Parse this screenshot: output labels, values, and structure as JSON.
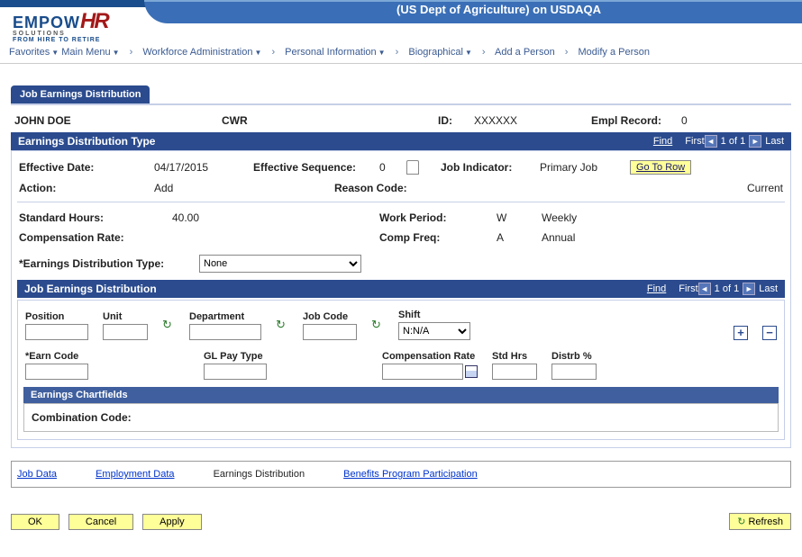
{
  "header": {
    "system_title": "(US Dept of Agriculture) on USDAQA",
    "logo_main": "EMPOW",
    "logo_hr": "HR",
    "logo_sub": "SOLUTIONS",
    "logo_tag": "FROM HIRE TO RETIRE"
  },
  "breadcrumbs": {
    "items": [
      {
        "label": "Favorites",
        "dropdown": true
      },
      {
        "label": "Main Menu",
        "dropdown": true
      },
      {
        "label": "Workforce Administration",
        "dropdown": true
      },
      {
        "label": "Personal Information",
        "dropdown": true
      },
      {
        "label": "Biographical",
        "dropdown": true
      },
      {
        "label": "Add a Person",
        "dropdown": false
      },
      {
        "label": "Modify a Person",
        "dropdown": false
      }
    ]
  },
  "tab": {
    "label": "Job Earnings Distribution"
  },
  "person": {
    "name": "JOHN DOE",
    "type": "CWR",
    "id_label": "ID:",
    "id_value": "XXXXXX",
    "empl_label": "Empl Record:",
    "empl_value": "0"
  },
  "section1": {
    "title": "Earnings Distribution Type",
    "find": "Find",
    "first": "First",
    "pager": "1 of 1",
    "last": "Last",
    "eff_date_label": "Effective Date:",
    "eff_date_value": "04/17/2015",
    "eff_seq_label": "Effective Sequence:",
    "eff_seq_value": "0",
    "job_ind_label": "Job Indicator:",
    "job_ind_value": "Primary Job",
    "go_to_row": "Go To Row",
    "action_label": "Action:",
    "action_value": "Add",
    "reason_label": "Reason Code:",
    "current": "Current",
    "std_hours_label": "Standard Hours:",
    "std_hours_value": "40.00",
    "work_period_label": "Work Period:",
    "work_period_code": "W",
    "work_period_text": "Weekly",
    "comp_rate_label": "Compensation Rate:",
    "comp_freq_label": "Comp Freq:",
    "comp_freq_code": "A",
    "comp_freq_text": "Annual",
    "dist_type_label": "*Earnings Distribution Type:",
    "dist_type_value": "None"
  },
  "section2": {
    "title": "Job Earnings Distribution",
    "find": "Find",
    "first": "First",
    "pager": "1 of 1",
    "last": "Last",
    "position_label": "Position",
    "unit_label": "Unit",
    "department_label": "Department",
    "job_code_label": "Job Code",
    "shift_label": "Shift",
    "shift_value": "N:N/A",
    "earn_code_label": "*Earn Code",
    "gl_pay_type_label": "GL Pay Type",
    "comp_rate_label": "Compensation Rate",
    "std_hrs_label": "Std Hrs",
    "distrb_label": "Distrb %",
    "chartfields_title": "Earnings Chartfields",
    "comb_code_label": "Combination Code:"
  },
  "bottom_links": {
    "job_data": "Job Data",
    "employment_data": "Employment Data",
    "earnings_dist": "Earnings Distribution",
    "benefits": "Benefits Program Participation"
  },
  "buttons": {
    "ok": "OK",
    "cancel": "Cancel",
    "apply": "Apply",
    "refresh": "Refresh"
  }
}
